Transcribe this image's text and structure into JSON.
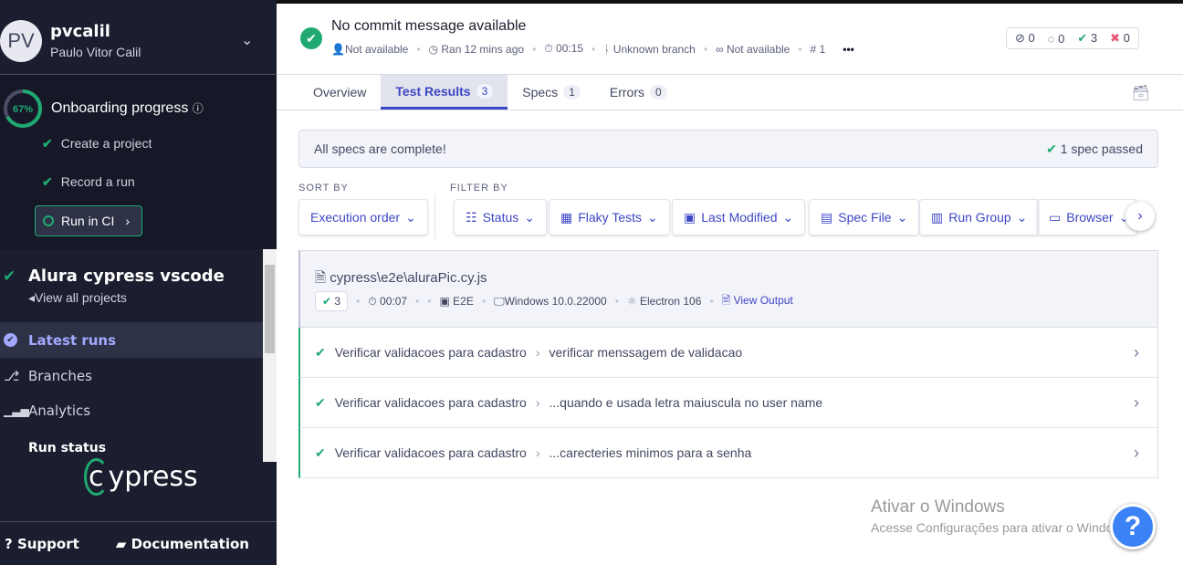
{
  "sidebar": {
    "avatar_initials": "PV",
    "username": "pvcalil",
    "full_name": "Paulo Vitor Calil",
    "onboarding": {
      "percent": 67,
      "percent_label": "67%",
      "title": "Onboarding progress",
      "steps": [
        {
          "label": "Create a project",
          "done": true
        },
        {
          "label": "Record a run",
          "done": true
        }
      ],
      "run_ci": "Run in CI"
    },
    "project": {
      "name": "Alura cypress vscode",
      "view_all": "View all projects"
    },
    "nav": [
      {
        "label": "Latest runs",
        "icon": "check-circle-icon",
        "active": true
      },
      {
        "label": "Branches",
        "icon": "branch-icon"
      },
      {
        "label": "Analytics",
        "icon": "bar-chart-icon"
      },
      {
        "label": "Run status"
      }
    ],
    "logo": "cypress",
    "footer": {
      "support": "Support",
      "documentation": "Documentation"
    }
  },
  "run": {
    "title": "No commit message available",
    "author": "Not available",
    "ran": "Ran 12 mins ago",
    "duration": "00:15",
    "branch": "Unknown branch",
    "ci": "Not available",
    "number": "1",
    "counts": {
      "skipped": "0",
      "pending": "0",
      "passed": "3",
      "failed": "0"
    }
  },
  "tabs": [
    {
      "label": "Overview"
    },
    {
      "label": "Test Results",
      "count": "3",
      "active": true
    },
    {
      "label": "Specs",
      "count": "1"
    },
    {
      "label": "Errors",
      "count": "0"
    }
  ],
  "banner": {
    "message": "All specs are complete!",
    "status": "1 spec passed"
  },
  "sort": {
    "label": "SORT BY",
    "value": "Execution order"
  },
  "filter": {
    "label": "FILTER BY",
    "items": [
      "Status",
      "Flaky Tests",
      "Last Modified",
      "Spec File",
      "Run Group",
      "Browser"
    ]
  },
  "spec": {
    "file": "cypress\\e2e\\aluraPic.cy.js",
    "passed": "3",
    "duration": "00:07",
    "testing_type": "E2E",
    "os": "Windows 10.0.22000",
    "browser": "Electron 106",
    "view_output": "View Output",
    "tests": [
      {
        "suite": "Verificar validacoes para cadastro",
        "name": "verificar menssagem de validacao"
      },
      {
        "suite": "Verificar validacoes para cadastro",
        "name": "...quando e usada letra maiuscula no user name"
      },
      {
        "suite": "Verificar validacoes para cadastro",
        "name": "...carecteries minimos para a senha"
      }
    ]
  },
  "watermark": {
    "title": "Ativar o Windows",
    "subtitle": "Acesse Configurações para ativar o Windows."
  },
  "colors": {
    "accent": "#3d46c4",
    "pass": "#1fa971",
    "fail": "#e45770",
    "sidebar": "#1b1e2e"
  }
}
